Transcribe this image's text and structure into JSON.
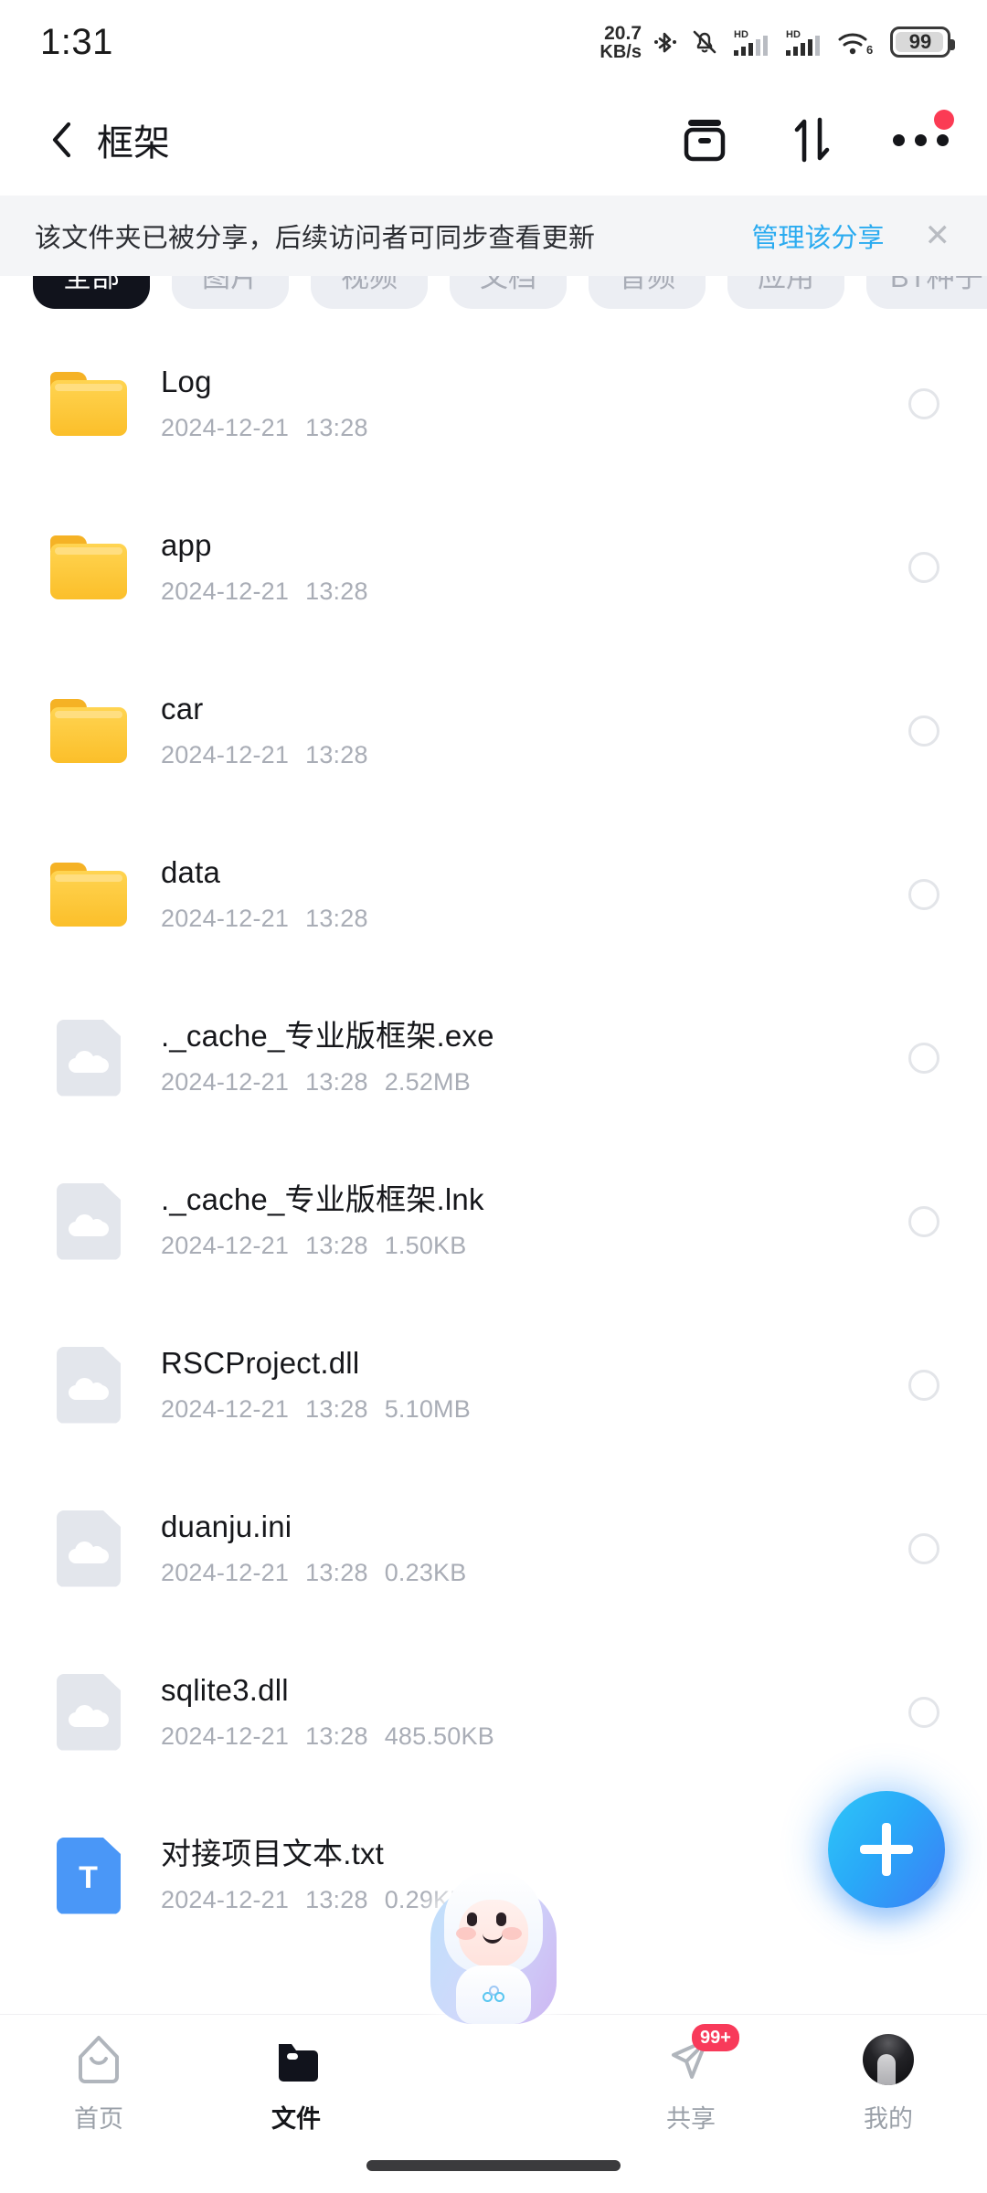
{
  "status_bar": {
    "time": "1:31",
    "net_speed_value": "20.7",
    "net_speed_unit": "KB/s",
    "battery_level": "99",
    "icons": [
      "bluetooth-icon",
      "mute-bell-icon",
      "hd-signal-icon",
      "hd-signal-icon",
      "wifi6-icon",
      "battery-icon"
    ],
    "wifi_generation": "6",
    "hd_label": "HD"
  },
  "header": {
    "title": "框架",
    "back_icon": "chevron-left-icon",
    "archive_icon": "archive-box-icon",
    "sort_icon": "sort-arrows-icon",
    "more_icon": "more-dots-icon",
    "has_more_badge": true
  },
  "banner": {
    "message": "该文件夹已被分享，后续访问者可同步查看更新",
    "action_label": "管理该分享",
    "close_label": "✕",
    "link_color": "#2aabf0",
    "background": "#f4f5f7"
  },
  "filters": {
    "items": [
      {
        "label": "全部",
        "active": true
      },
      {
        "label": "图片",
        "active": false
      },
      {
        "label": "视频",
        "active": false
      },
      {
        "label": "文档",
        "active": false
      },
      {
        "label": "音频",
        "active": false
      },
      {
        "label": "应用",
        "active": false
      },
      {
        "label": "BT种子",
        "active": false
      }
    ]
  },
  "files": [
    {
      "name": "Log",
      "date": "2024-12-21",
      "time": "13:28",
      "size": "",
      "icon": "folder-icon"
    },
    {
      "name": "app",
      "date": "2024-12-21",
      "time": "13:28",
      "size": "",
      "icon": "folder-icon"
    },
    {
      "name": "car",
      "date": "2024-12-21",
      "time": "13:28",
      "size": "",
      "icon": "folder-icon"
    },
    {
      "name": "data",
      "date": "2024-12-21",
      "time": "13:28",
      "size": "",
      "icon": "folder-icon"
    },
    {
      "name": "._cache_专业版框架.exe",
      "date": "2024-12-21",
      "time": "13:28",
      "size": "2.52MB",
      "icon": "cloud-file-icon"
    },
    {
      "name": "._cache_专业版框架.lnk",
      "date": "2024-12-21",
      "time": "13:28",
      "size": "1.50KB",
      "icon": "cloud-file-icon"
    },
    {
      "name": "RSCProject.dll",
      "date": "2024-12-21",
      "time": "13:28",
      "size": "5.10MB",
      "icon": "cloud-file-icon"
    },
    {
      "name": "duanju.ini",
      "date": "2024-12-21",
      "time": "13:28",
      "size": "0.23KB",
      "icon": "cloud-file-icon"
    },
    {
      "name": "sqlite3.dll",
      "date": "2024-12-21",
      "time": "13:28",
      "size": "485.50KB",
      "icon": "cloud-file-icon"
    },
    {
      "name": "对接项目文本.txt",
      "date": "2024-12-21",
      "time": "13:28",
      "size": "0.29KB",
      "icon": "txt-file-icon",
      "icon_letter": "T"
    }
  ],
  "fab": {
    "icon": "plus-icon",
    "color_start": "#2fc6f8",
    "color_end": "#3d7ef6"
  },
  "bottom_nav": {
    "items": [
      {
        "label": "首页",
        "icon": "home-icon",
        "active": false,
        "badge": ""
      },
      {
        "label": "文件",
        "icon": "files-icon",
        "active": true,
        "badge": ""
      },
      {
        "label": "共享",
        "icon": "share-plane-icon",
        "active": false,
        "badge": "99+"
      },
      {
        "label": "我的",
        "icon": "avatar-icon",
        "active": false,
        "badge": ""
      }
    ],
    "center_button_icon": "mascot-icon",
    "badge_color": "#f83a5a"
  }
}
